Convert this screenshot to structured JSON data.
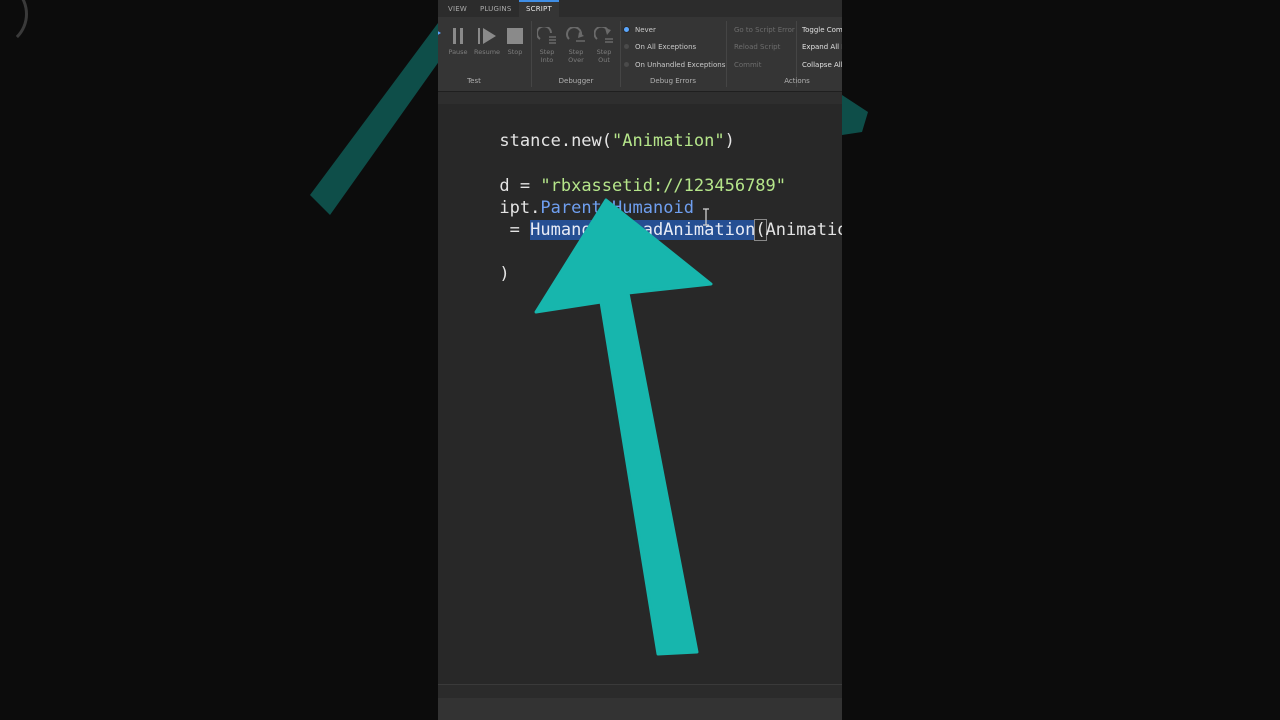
{
  "ribbon": {
    "tabs": [
      {
        "label": "VIEW",
        "active": false
      },
      {
        "label": "PLUGINS",
        "active": false
      },
      {
        "label": "SCRIPT",
        "active": true
      }
    ],
    "test": {
      "group_label": "Test",
      "pause": "Pause",
      "resume": "Resume",
      "stop": "Stop"
    },
    "debugger": {
      "group_label": "Debugger",
      "step_into": [
        "Step",
        "Into"
      ],
      "step_over": [
        "Step",
        "Over"
      ],
      "step_out": [
        "Step",
        "Out"
      ]
    },
    "debug_errors": {
      "group_label": "Debug Errors",
      "options": [
        "Never",
        "On All Exceptions",
        "On Unhandled Exceptions"
      ],
      "selected": "Never"
    },
    "script_actions": {
      "go_to_script_error": "Go to Script Error",
      "reload_script": "Reload Script",
      "commit": "Commit"
    },
    "actions": {
      "group_label": "Actions",
      "toggle_comment": "Toggle Com",
      "expand_all": "Expand All F",
      "collapse_all": "Collapse All"
    }
  },
  "editor": {
    "lines": [
      {
        "parts": [
          [
            "stance.new(",
            "white"
          ],
          [
            "\"Animation\"",
            "green"
          ],
          [
            ")",
            "white"
          ]
        ]
      },
      {
        "parts": [
          [
            "d = ",
            "white"
          ],
          [
            "\"rbxassetid://123456789\"",
            "green"
          ]
        ]
      },
      {
        "parts": [
          [
            "ipt.",
            "white"
          ],
          [
            "Parent",
            "blue"
          ],
          [
            ".",
            "white"
          ],
          [
            "Humanoid",
            "blue"
          ]
        ]
      },
      {
        "parts": [
          [
            " = ",
            "white"
          ],
          [
            "Humanoid:LoadAnimation",
            "sel"
          ],
          [
            "(",
            "bracket"
          ],
          [
            "Animation",
            "white"
          ],
          [
            ")",
            "bracket"
          ]
        ]
      },
      {
        "parts": [
          [
            ")",
            "white"
          ]
        ]
      }
    ]
  },
  "colors": {
    "arrow": "#17b6ad",
    "selection": "#254f93",
    "string": "#b5e58a",
    "property": "#6f9ff0"
  }
}
